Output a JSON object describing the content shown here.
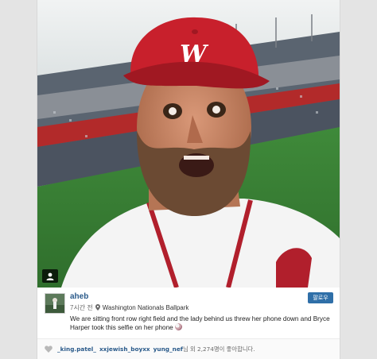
{
  "post": {
    "username": "aheb",
    "time": "7시간 전",
    "location": "Washington Nationals Ballpark",
    "follow_label": "팔로우",
    "caption": "We are sitting front row right field and the lady behind us threw her phone down and Bryce Harper took this selfie on her phone",
    "caption_emoji": "baseball-emoji"
  },
  "likes": {
    "users": [
      "_king.patel_",
      "xxjewish_boyxx",
      "yung_nef"
    ],
    "suffix": "님 외 2,274명이 좋아합니다."
  },
  "colors": {
    "follow_button": "#2f6fa8",
    "username": "#2a5a8a",
    "page_bg": "#e4e4e4"
  },
  "icons": {
    "tag": "person-tag-icon",
    "location": "location-pin-icon",
    "heart": "heart-icon"
  }
}
